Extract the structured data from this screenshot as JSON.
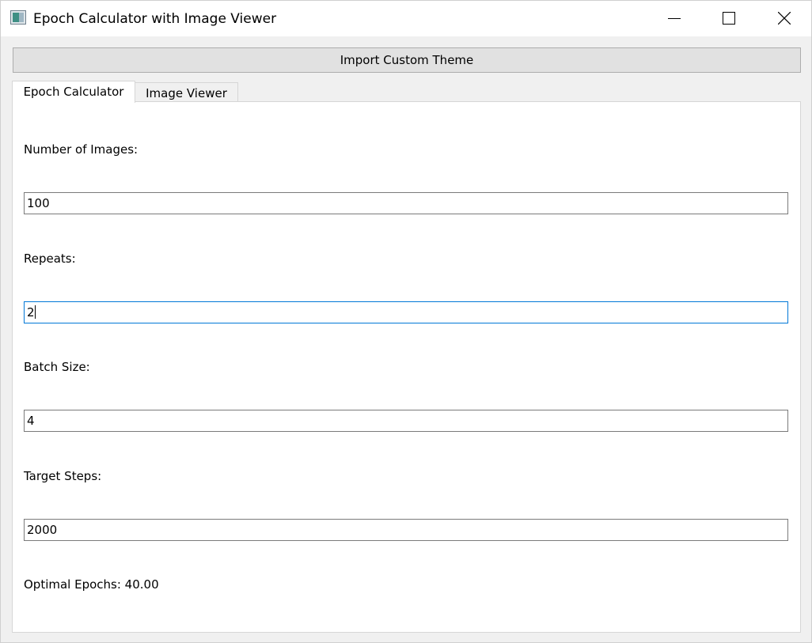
{
  "window": {
    "title": "Epoch Calculator with Image Viewer"
  },
  "toolbar": {
    "import_theme_label": "Import Custom Theme"
  },
  "tabs": [
    {
      "label": "Epoch Calculator",
      "selected": true
    },
    {
      "label": "Image Viewer",
      "selected": false
    }
  ],
  "form": {
    "images_label": "Number of Images:",
    "images_value": "100",
    "repeats_label": "Repeats:",
    "repeats_value": "2",
    "batch_label": "Batch Size:",
    "batch_value": "4",
    "steps_label": "Target Steps:",
    "steps_value": "2000"
  },
  "result": {
    "text": "Optimal Epochs: 40.00"
  },
  "icons": {
    "app": "app-icon",
    "minimize": "minimize-icon",
    "maximize": "maximize-icon",
    "close": "close-icon"
  },
  "colors": {
    "focus_border": "#0078d7",
    "button_bg": "#e1e1e1",
    "window_bg": "#f0f0f0"
  }
}
